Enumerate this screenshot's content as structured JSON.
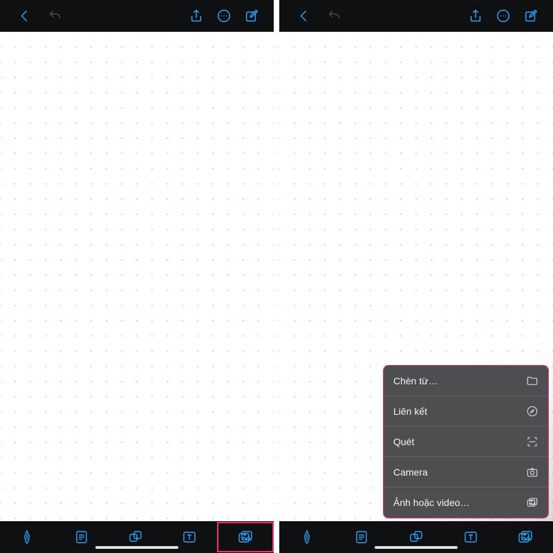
{
  "colors": {
    "accent": "#2aa7ff",
    "highlight": "#ff2d6c",
    "bar_bg": "#0e1012",
    "popup_bg": "#4c4f52"
  },
  "topbar": {
    "back": "back-icon",
    "undo": "undo-icon",
    "share": "share-icon",
    "more": "more-icon",
    "compose": "compose-icon"
  },
  "bottombar": {
    "items": [
      {
        "name": "pen-tool-icon"
      },
      {
        "name": "notes-tool-icon"
      },
      {
        "name": "shapes-tool-icon"
      },
      {
        "name": "text-tool-icon"
      },
      {
        "name": "image-tool-icon"
      }
    ]
  },
  "popup": {
    "items": [
      {
        "label": "Chèn từ…",
        "icon": "folder-icon"
      },
      {
        "label": "Liên kết",
        "icon": "compass-icon"
      },
      {
        "label": "Quét",
        "icon": "scan-icon"
      },
      {
        "label": "Camera",
        "icon": "camera-icon"
      },
      {
        "label": "Ảnh hoặc video…",
        "icon": "gallery-icon"
      }
    ]
  }
}
